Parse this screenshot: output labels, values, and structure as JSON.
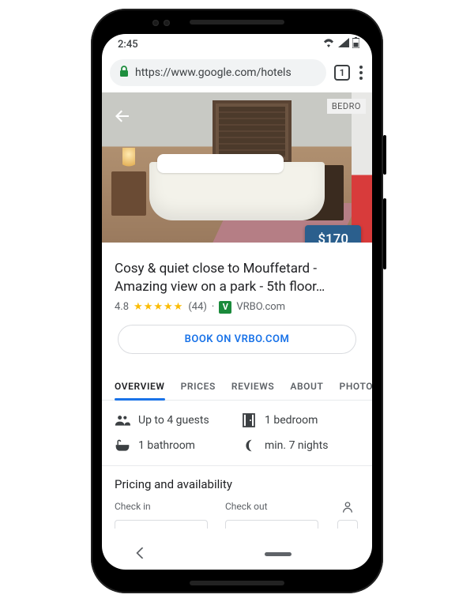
{
  "status": {
    "time": "2:45"
  },
  "urlbar": {
    "url": "https://www.google.com/hotels",
    "tabcount": "1"
  },
  "hero": {
    "badge": "BEDRO",
    "price": "$170"
  },
  "listing": {
    "title": "Cosy & quiet close to Mouffetard - Amazing view on a park - 5th floor…",
    "rating": "4.8",
    "reviews": "(44)",
    "sep": "·",
    "source": "VRBO.com"
  },
  "cta": {
    "book": "BOOK ON VRBO.COM"
  },
  "tabs": {
    "overview": "OVERVIEW",
    "prices": "PRICES",
    "reviews": "REVIEWS",
    "about": "ABOUT",
    "photos": "PHOTOS"
  },
  "amen": {
    "guests": "Up to 4 guests",
    "bedroom": "1 bedroom",
    "bath": "1 bathroom",
    "min": "min. 7 nights"
  },
  "pricing": {
    "heading": "Pricing and availability",
    "checkin": "Check in",
    "checkout": "Check out"
  }
}
